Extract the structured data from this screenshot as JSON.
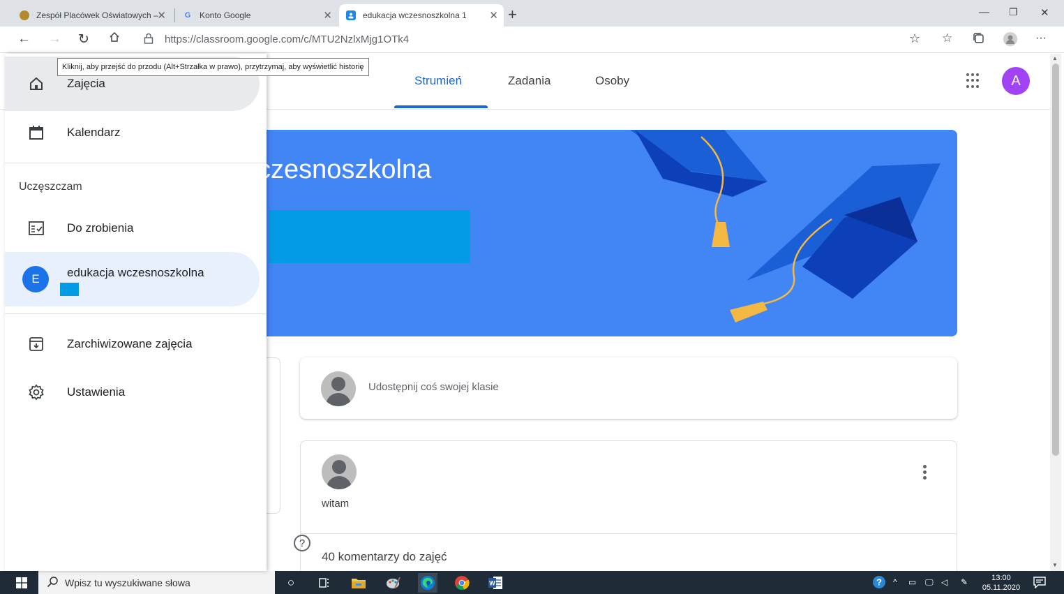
{
  "browser": {
    "tabs": [
      {
        "title": "Zespół Placówek Oświatowych – ",
        "active": false
      },
      {
        "title": "Konto Google",
        "active": false
      },
      {
        "title": "edukacja wczesnoszkolna 1",
        "active": true
      }
    ],
    "url_host": "https://classroom.google.com",
    "url_path": "/c/MTU2NzlxMjg1OTk4",
    "tooltip": "Kliknij, aby przejść do przodu (Alt+Strzałka w prawo), przytrzymaj, aby wyświetlić historię"
  },
  "classroom": {
    "tabs": [
      {
        "label": "Strumień",
        "active": true
      },
      {
        "label": "Zadania",
        "active": false
      },
      {
        "label": "Osoby",
        "active": false
      }
    ],
    "account_initial": "A",
    "banner_title": "vczesnoszkolna",
    "share_placeholder": "Udostępnij coś swojej klasie",
    "post_text": "witam",
    "comments_label": "40 komentarzy do zajęć",
    "help_glyph": "?"
  },
  "drawer": {
    "top_items": [
      {
        "label": "Zajęcia",
        "icon": "home-icon"
      },
      {
        "label": "Kalendarz",
        "icon": "calendar-icon"
      }
    ],
    "section_title": "Uczęszczam",
    "todo_label": "Do zrobienia",
    "enrolled_class": {
      "initial": "E",
      "name": "edukacja wczesnoszkolna"
    },
    "bottom_items": [
      {
        "label": "Zarchiwizowane zajęcia",
        "icon": "archive-icon"
      },
      {
        "label": "Ustawienia",
        "icon": "settings-icon"
      }
    ]
  },
  "taskbar": {
    "search_placeholder": "Wpisz tu wyszukiwane słowa",
    "time": "13:00",
    "date": "05.11.2020"
  },
  "colors": {
    "accent": "#1967d2",
    "banner": "#4285f4",
    "account_avatar": "#a142f4",
    "redaction": "#039be5"
  }
}
